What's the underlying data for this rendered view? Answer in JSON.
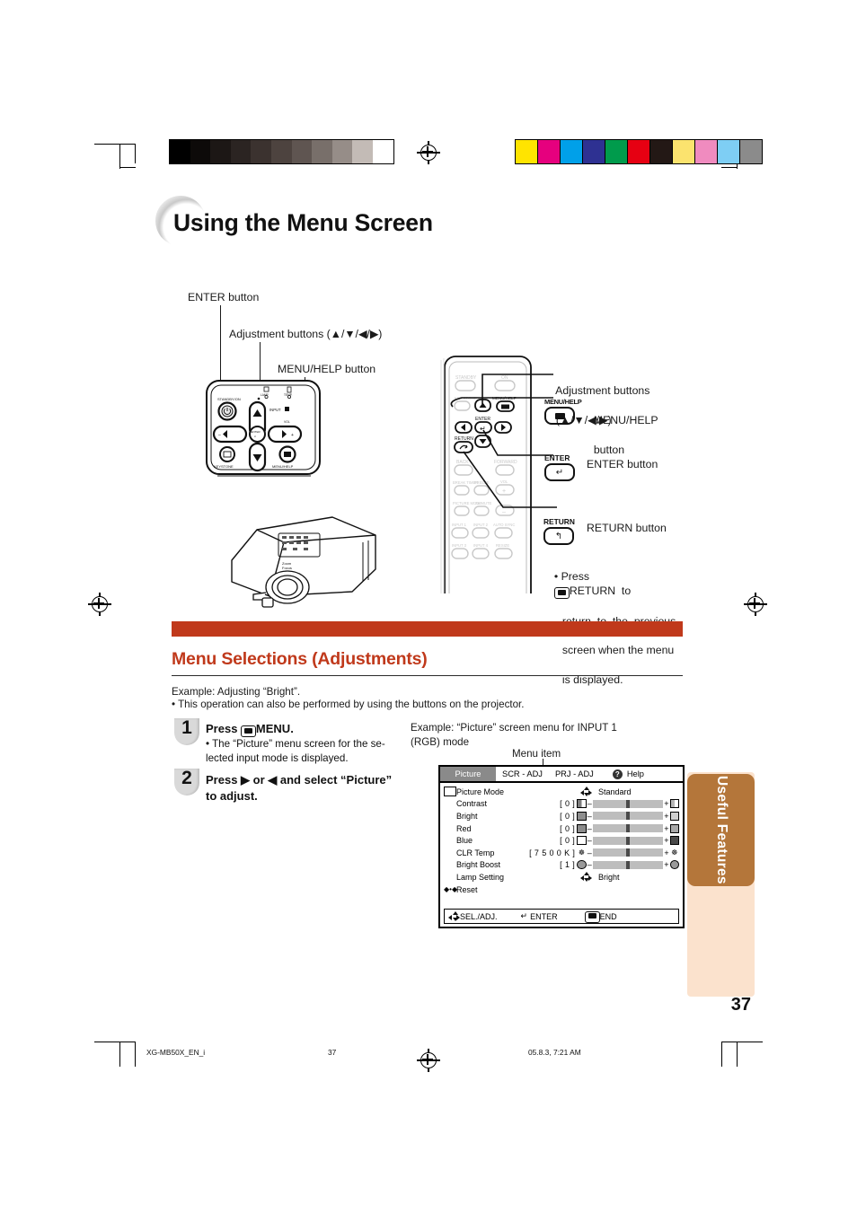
{
  "page": {
    "title": "Using the Menu Screen",
    "number": "37"
  },
  "callouts_left": {
    "enter": "ENTER button",
    "adjustment": "Adjustment buttons (▲/▼/◀/▶)",
    "menu_help": "MENU/HELP button"
  },
  "callouts_right": {
    "adjustment_l1": "Adjustment buttons",
    "adjustment_l2": "(▲/▼/◀/▶)",
    "menu_help_l1": "MENU/HELP",
    "menu_help_l2": "button",
    "enter": "ENTER button",
    "return": "RETURN button",
    "note_l1": "• Press",
    "note_l2": "RETURN  to",
    "note_l3": "return  to  the  previous",
    "note_l4": "screen when the menu",
    "note_l5": "is displayed."
  },
  "remote_keys": {
    "menu_help": "MENU/HELP",
    "enter": "ENTER",
    "return": "RETURN",
    "standby": "STANDBY",
    "on": "ON",
    "keystone": "KEYSTONE",
    "back": "BACK",
    "forward": "FORWARD",
    "break_timer": "BREAK TIMER",
    "freeze": "FREEZE",
    "vol": "VOL",
    "picture_mode": "PICTURE MODE",
    "av_mute": "AV MUTE",
    "input1": "INPUT 1",
    "input2": "INPUT 2",
    "auto_sync": "AUTO SYNC",
    "input3": "INPUT 3",
    "input4": "INPUT 4",
    "resize": "RESIZE"
  },
  "panel_keys": {
    "standby_on": "STANDBY/ON",
    "lamp": "LAMP",
    "temp": "TEMP.",
    "input": "INPUT",
    "vol": "VOL",
    "keystone": "KEYSTONE",
    "enter": "ENTER",
    "menu_help": "MENU/HELP"
  },
  "section": {
    "heading": "Menu Selections (Adjustments)",
    "example_line": "Example: Adjusting “Bright”.",
    "note_line": "• This operation can also be performed by using the buttons on the projector."
  },
  "steps": [
    {
      "num": "1",
      "title_pre": "Press",
      "title_post": "MENU.",
      "sub_l1": "• The “Picture” menu screen for the se-",
      "sub_l2": "  lected input mode is displayed."
    },
    {
      "num": "2",
      "title_l1": "Press ▶ or ◀ and select “Picture”",
      "title_l2": "to adjust."
    }
  ],
  "osd_caption": {
    "example_l1": "Example: “Picture” screen menu for INPUT 1",
    "example_l2": "(RGB) mode",
    "menu_item_label": "Menu item"
  },
  "osd": {
    "tabs": [
      {
        "label": "Picture",
        "selected": true
      },
      {
        "label": "SCR - ADJ",
        "selected": false
      },
      {
        "label": "PRJ - ADJ",
        "selected": false
      },
      {
        "label": "Help",
        "selected": false,
        "icon": "question-mark-icon"
      }
    ],
    "rows": [
      {
        "name": "Picture Mode",
        "type": "choice",
        "icon": "picture-mode-icon",
        "value": "Standard"
      },
      {
        "name": "Contrast",
        "type": "slider",
        "bracket": "[          0 ]",
        "slider_pct": 50,
        "left_icon": "contrast-low-icon",
        "right_icon": "contrast-high-icon"
      },
      {
        "name": "Bright",
        "type": "slider",
        "bracket": "[          0 ]",
        "slider_pct": 50,
        "left_icon": "bright-low-icon",
        "right_icon": "bright-high-icon"
      },
      {
        "name": "Red",
        "type": "slider",
        "bracket": "[          0 ]",
        "slider_pct": 50,
        "left_icon": "red-low-icon",
        "right_icon": "red-high-icon"
      },
      {
        "name": "Blue",
        "type": "slider",
        "bracket": "[          0 ]",
        "slider_pct": 50,
        "left_icon": "blue-low-icon",
        "right_icon": "blue-high-icon"
      },
      {
        "name": "CLR Temp",
        "type": "slider",
        "bracket": "[    7 5 0 0 K ]",
        "slider_pct": 50,
        "left_icon": "clr-temp-low-icon",
        "right_icon": "clr-temp-high-icon"
      },
      {
        "name": "Bright Boost",
        "type": "slider",
        "bracket": "[          1 ]",
        "slider_pct": 50,
        "left_icon": "bright-boost-low-icon",
        "right_icon": "bright-boost-high-icon"
      },
      {
        "name": "Lamp Setting",
        "type": "choice",
        "value": "Bright"
      },
      {
        "name": "Reset",
        "type": "reset"
      }
    ],
    "footer": {
      "sel_adj": "SEL./ADJ.",
      "enter": "ENTER",
      "end": "END"
    }
  },
  "side_tab": {
    "label": "Useful\nFeatures"
  },
  "footer": {
    "file": "XG-MB50X_EN_i",
    "page": "37",
    "timestamp": "05.8.3, 7:21 AM"
  },
  "colors": {
    "accent_orange": "#c0391b",
    "tab_brown": "#b4763a",
    "tab_panel": "#fbe2cd",
    "osd_selected_tab": "#8a8a8a",
    "color_bar_left": [
      "#000000",
      "#0d0a09",
      "#1c1715",
      "#2b2422",
      "#3b322f",
      "#4d433f",
      "#5f5551",
      "#786f6a",
      "#968d88",
      "#c3bbb6",
      "#ffffff"
    ],
    "color_bar_right": [
      "#ffe400",
      "#e6007e",
      "#00a0e9",
      "#2e3192",
      "#009b4c",
      "#e60012",
      "#231815",
      "#fbe36e",
      "#f08bbf",
      "#7ecef4",
      "#8b8b8b"
    ]
  }
}
